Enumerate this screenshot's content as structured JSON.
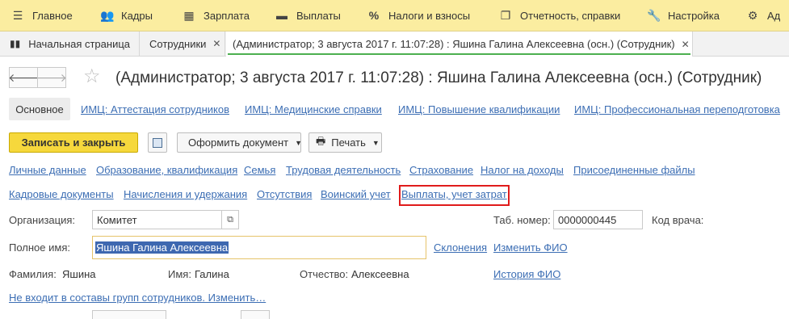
{
  "menu": {
    "items": [
      {
        "label": "Главное",
        "icon": "hamburger-icon"
      },
      {
        "label": "Кадры",
        "icon": "people-icon"
      },
      {
        "label": "Зарплата",
        "icon": "calculator-icon"
      },
      {
        "label": "Выплаты",
        "icon": "wallet-icon"
      },
      {
        "label": "Налоги и взносы",
        "icon": "percent-icon"
      },
      {
        "label": "Отчетность, справки",
        "icon": "documents-icon"
      },
      {
        "label": "Настройка",
        "icon": "wrench-icon"
      },
      {
        "label": "Ад",
        "icon": "gear-icon"
      }
    ]
  },
  "tabs": [
    {
      "label": "Начальная страница"
    },
    {
      "label": "Сотрудники"
    },
    {
      "label": "(Администратор; 3 августа 2017 г. 11:07:28) : Яшина Галина Алексеевна (осн.) (Сотрудник)"
    }
  ],
  "title": "(Администратор; 3 августа 2017 г. 11:07:28) : Яшина Галина Алексеевна (осн.) (Сотрудник)",
  "form_links": {
    "main": "Основное",
    "items": [
      "ИМЦ: Аттестация сотрудников",
      "ИМЦ: Медицинские справки",
      "ИМЦ: Повышение квалификации",
      "ИМЦ: Профессиональная переподготовка"
    ]
  },
  "toolbar": {
    "save_close": "Записать и закрыть",
    "issue_document": "Оформить документ",
    "print": "Печать"
  },
  "sections": {
    "row1": [
      "Личные данные",
      "Образование, квалификация",
      "Семья",
      "Трудовая деятельность",
      "Страхование",
      "Налог на доходы",
      "Присоединенные файлы"
    ],
    "row2": [
      "Кадровые документы",
      "Начисления и удержания",
      "Отсутствия",
      "Воинский учет",
      "Выплаты, учет затрат"
    ]
  },
  "fields": {
    "organization_label": "Организация:",
    "organization_value": "Комитет",
    "tab_number_label": "Таб. номер:",
    "tab_number_value": "0000000445",
    "doctor_code_label": "Код врача:",
    "full_name_label": "Полное имя:",
    "full_name_value": "Яшина Галина Алексеевна",
    "declensions_link": "Склонения",
    "change_name_link": "Изменить ФИО",
    "last_name_label": "Фамилия:",
    "last_name_value": "Яшина",
    "first_name_label": "Имя:",
    "first_name_value": "Галина",
    "patronymic_label": "Отчество:",
    "patronymic_value": "Алексеевна",
    "name_history_link": "История ФИО",
    "groups_link": "Не входит в составы групп сотрудников. Изменить…"
  },
  "colors": {
    "menubar": "#fbeda0",
    "accent_button": "#f6d83c",
    "link": "#3c6eb4",
    "highlight_box": "#e01b1b",
    "active_tab_line": "#4caf50"
  }
}
